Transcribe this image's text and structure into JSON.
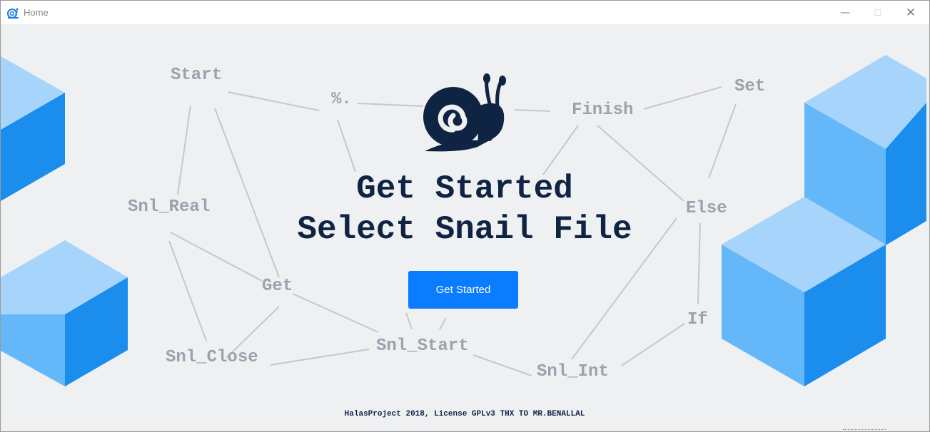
{
  "window": {
    "title": "Home",
    "controls": {
      "minimize": "—",
      "maximize": "☐",
      "close": "✕"
    }
  },
  "hero": {
    "line1": "Get Started",
    "line2": "Select Snail File",
    "button_label": "Get Started"
  },
  "keywords": {
    "start": "Start",
    "percent": "%.",
    "finish": "Finish",
    "set": "Set",
    "snl_real": "Snl_Real",
    "else": "Else",
    "get": "Get",
    "if": "If",
    "snl_close": "Snl_Close",
    "snl_start": "Snl_Start",
    "snl_int": "Snl_Int"
  },
  "footer": {
    "text": "HalasProject 2018, License GPLv3 THX TO MR.BENALLAL"
  },
  "colors": {
    "background": "#eff0f2",
    "accent": "#0a7cff",
    "navy": "#0f2343",
    "keyword": "#9ca1ad",
    "cube_top": "#a6d4fb",
    "cube_left": "#64b7f8",
    "cube_right": "#1a8ded"
  },
  "icons": [
    "app-snail-icon",
    "snail-logo-icon"
  ]
}
